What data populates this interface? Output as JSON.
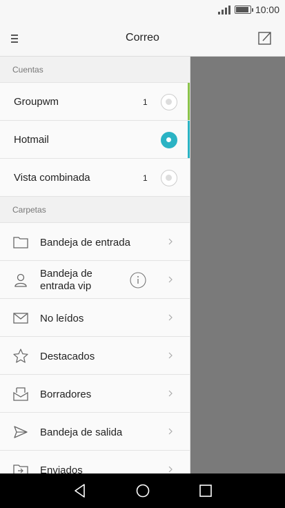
{
  "status": {
    "time": "10:00"
  },
  "header": {
    "title": "Correo"
  },
  "accounts": {
    "section_label": "Cuentas",
    "items": [
      {
        "label": "Groupwm",
        "count": "1",
        "selected": false,
        "accent": "#8bc34a"
      },
      {
        "label": "Hotmail",
        "count": "",
        "selected": true,
        "accent": "#2bb3c4"
      },
      {
        "label": "Vista combinada",
        "count": "1",
        "selected": false,
        "accent": ""
      }
    ]
  },
  "folders": {
    "section_label": "Carpetas",
    "items": [
      {
        "label": "Bandeja de entrada",
        "icon": "folder-icon"
      },
      {
        "label": "Bandeja de entrada vip",
        "icon": "person-icon"
      },
      {
        "label": "No leídos",
        "icon": "envelope-icon"
      },
      {
        "label": "Destacados",
        "icon": "star-icon"
      },
      {
        "label": "Borradores",
        "icon": "draft-icon"
      },
      {
        "label": "Bandeja de salida",
        "icon": "send-icon"
      },
      {
        "label": "Enviados",
        "icon": "sent-folder-icon"
      }
    ]
  },
  "colors": {
    "accent": "#2bb3c4",
    "scrim": "#7a7a7a"
  }
}
